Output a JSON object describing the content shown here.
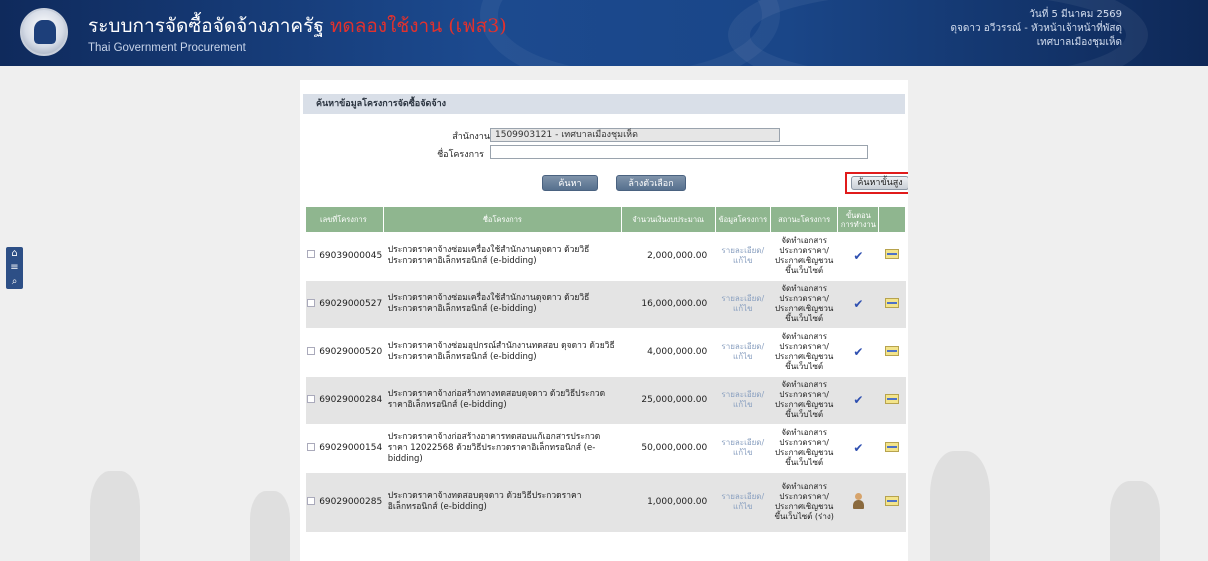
{
  "header": {
    "title_main": "ระบบการจัดซื้อจัดจ้างภาครัฐ",
    "title_test": "ทดลองใช้งาน (เฟส3)",
    "subtitle": "Thai Government Procurement",
    "date": "วันที่ 5 มีนาคม 2569",
    "user": "ดุจดาว อวีวรรณ์ - หัวหน้าเจ้าหน้าที่พัสดุ",
    "org": "เทศบาลเมืองชุมเห็ด"
  },
  "side_tools": [
    "home-icon",
    "menu-icon",
    "search-icon"
  ],
  "panel": {
    "title": "ค้นหาข้อมูลโครงการจัดซื้อจัดจ้าง",
    "agency_label": "สำนักงาน",
    "agency_value": "1509903121 - เทศบาลเมืองชุมเห็ด",
    "project_label": "ชื่อโครงการ",
    "project_value": "",
    "search_btn": "ค้นหา",
    "clear_btn": "ล้างตัวเลือก",
    "advanced_btn": "ค้นหาขั้นสูง"
  },
  "table": {
    "headers": {
      "no": "เลขที่โครงการ",
      "name": "ชื่อโครงการ",
      "amount": "จำนวนเงินงบประมาณ",
      "info": "ข้อมูลโครงการ",
      "status": "สถานะโครงการ",
      "step": "ขั้นตอนการทำงาน"
    },
    "rows": [
      {
        "no": "69039000045",
        "name": "ประกวดราคาจ้างซ่อมเครื่องใช้สำนักงานดุจดาว ด้วยวิธีประกวดราคาอิเล็กทรอนิกส์ (e-bidding)",
        "amount": "2,000,000.00",
        "link": "รายละเอียด/แก้ไข",
        "status": "จัดทำเอกสารประกวดราคา/ประกาศเชิญชวนขึ้นเว็บไซต์"
      },
      {
        "no": "69029000527",
        "name": "ประกวดราคาจ้างซ่อมเครื่องใช้สำนักงานดุจดาว ด้วยวิธีประกวดราคาอิเล็กทรอนิกส์ (e-bidding)",
        "amount": "16,000,000.00",
        "link": "รายละเอียด/แก้ไข",
        "status": "จัดทำเอกสารประกวดราคา/ประกาศเชิญชวนขึ้นเว็บไซต์"
      },
      {
        "no": "69029000520",
        "name": "ประกวดราคาจ้างซ่อมอุปกรณ์สำนักงานทดสอบ ดุจดาว ด้วยวิธีประกวดราคาอิเล็กทรอนิกส์ (e-bidding)",
        "amount": "4,000,000.00",
        "link": "รายละเอียด/แก้ไข",
        "status": "จัดทำเอกสารประกวดราคา/ประกาศเชิญชวนขึ้นเว็บไซต์"
      },
      {
        "no": "69029000284",
        "name": "ประกวดราคาจ้างก่อสร้างทางทดสอบดุจดาว ด้วยวิธีประกวดราคาอิเล็กทรอนิกส์ (e-bidding)",
        "amount": "25,000,000.00",
        "link": "รายละเอียด/แก้ไข",
        "status": "จัดทำเอกสารประกวดราคา/ประกาศเชิญชวนขึ้นเว็บไซต์"
      },
      {
        "no": "69029000154",
        "name": "ประกวดราคาจ้างก่อสร้างอาคารทดสอบแก้เอกสารประกวดราคา 12022568 ด้วยวิธีประกวดราคาอิเล็กทรอนิกส์ (e-bidding)",
        "amount": "50,000,000.00",
        "link": "รายละเอียด/แก้ไข",
        "status": "จัดทำเอกสารประกวดราคา/ประกาศเชิญชวนขึ้นเว็บไซต์"
      },
      {
        "no": "69029000285",
        "name": "ประกวดราคาจ้างทดสอบดุจดาว ด้วยวิธีประกวดราคาอิเล็กทรอนิกส์ (e-bidding)",
        "amount": "1,000,000.00",
        "link": "รายละเอียด/แก้ไข",
        "status": "จัดทำเอกสารประกวดราคา/ประกาศเชิญชวนขึ้นเว็บไซต์ (ร่าง)"
      }
    ],
    "step_icons": [
      "check-icon",
      "check-icon",
      "check-icon",
      "check-icon",
      "check-icon",
      "person-icon"
    ]
  }
}
